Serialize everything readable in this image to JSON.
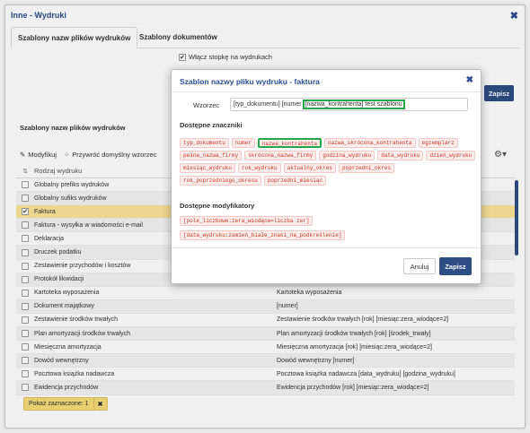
{
  "window": {
    "title": "Inne - Wydruki",
    "close": "✖"
  },
  "tabs": [
    {
      "label": "Szablony nazw plików wydruków"
    },
    {
      "label": "Szablony dokumentów"
    }
  ],
  "footer_checkbox": {
    "label": "Włącz stopkę na wydrukach",
    "checked": true
  },
  "background_save_label": "Zapisz",
  "section_title": "Szablony nazw plików wydruków",
  "toolbar": {
    "modify_label": "Modyfikuj",
    "restore_label": "Przywróć domyślny wzorzec"
  },
  "table": {
    "header": "Rodzaj wydruku",
    "rows": [
      {
        "name": "Globalny prefiks wydruków",
        "pattern": ""
      },
      {
        "name": "Globalny sufiks wydruków",
        "pattern": ""
      },
      {
        "name": "Faktura",
        "pattern": "",
        "checked": true
      },
      {
        "name": "Faktura - wysyłka w wiadomości e-mail",
        "pattern": ""
      },
      {
        "name": "Deklaracja",
        "pattern": ""
      },
      {
        "name": "Druczek podatku",
        "pattern": ""
      },
      {
        "name": "Zestawienie przychodów i kosztów",
        "pattern": ""
      },
      {
        "name": "Protokół likwidacji",
        "pattern": ""
      },
      {
        "name": "Kartoteka wyposażenia",
        "pattern": "Kartoteka wyposażenia"
      },
      {
        "name": "Dokument majątkowy",
        "pattern": "[numer]"
      },
      {
        "name": "Zestawienie środków trwałych",
        "pattern": "Zestawienie środków trwałych [rok] [miesiąc:zera_wiodące=2]"
      },
      {
        "name": "Plan amortyzacji środków trwałych",
        "pattern": "Plan amortyzacji środków trwałych [rok] [środek_trwały]"
      },
      {
        "name": "Miesięczna amortyzacja",
        "pattern": "Miesięczna amortyzacja [rok] [miesiąc:zera_wiodące=2]"
      },
      {
        "name": "Dowód wewnętrzny",
        "pattern": "Dowód wewnętrzny [numer]"
      },
      {
        "name": "Pocztowa książka nadawcza",
        "pattern": "Pocztowa książka nadawcza [data_wydruku] [godzina_wydruku]"
      },
      {
        "name": "Ewidencja przychodów",
        "pattern": "Ewidencja przychodów [rok] [miesiąc:zera_wiodące=2]"
      }
    ]
  },
  "pokaz": {
    "label": "Pokaż zaznaczone: 1",
    "close": "✖"
  },
  "modal": {
    "title": "Szablon nazwy pliku wydruku - faktura",
    "close": "✖",
    "wzorzec_label": "Wzorzec",
    "wzorzec_prefix": "[typ_dokumentu] [numer",
    "wzorzec_highlight": "[nazwa_kontrahenta] test szablonu",
    "tokens_title": "Dostępne znaczniki",
    "tokens": [
      "typ_dokumentu",
      "numer",
      "nazwa_kontrahenta",
      "nazwa_skrócona_kontrahenta",
      "egzemplarz",
      "pełna_nazwa_firmy",
      "skrócona_nazwa_firmy",
      "godzina_wydruku",
      "data_wydruku",
      "dzień_wydruku",
      "miesiąc_wydruku",
      "rok_wydruku",
      "aktualny_okres",
      "poprzedni_okres",
      "rok_poprzedniego_okresu",
      "poprzedni_miesiąc"
    ],
    "highlighted_token": "nazwa_kontrahenta",
    "modifiers_title": "Dostępne modyfikatory",
    "modifiers": [
      "[pole_liczbowe:zera_wiodące=liczba zer]",
      "[data_wydruku:zamień_białe_znaki_na_podkreślenie]"
    ],
    "cancel_label": "Anuluj",
    "save_label": "Zapisz"
  },
  "icons": {
    "modify": "pencil-icon",
    "restore": "spinner-icon",
    "settings": "gears-icon",
    "sort": "sort-icon"
  },
  "colors": {
    "accent": "#2e4d85",
    "title": "#2a4d8f",
    "selected_row": "#fbe49a",
    "highlight_border": "#22a84a",
    "token_text": "#c0392b"
  }
}
